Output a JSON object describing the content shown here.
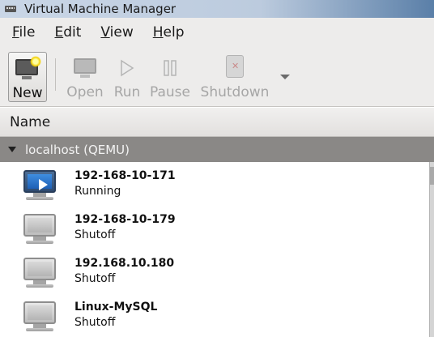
{
  "window": {
    "title": "Virtual Machine Manager",
    "icon": "vmm-app-icon"
  },
  "menu": [
    {
      "mnemonic": "F",
      "rest": "ile"
    },
    {
      "mnemonic": "E",
      "rest": "dit"
    },
    {
      "mnemonic": "V",
      "rest": "iew"
    },
    {
      "mnemonic": "H",
      "rest": "elp"
    }
  ],
  "toolbar": {
    "new_label": "New",
    "open_label": "Open",
    "run_label": "Run",
    "pause_label": "Pause",
    "shutdown_label": "Shutdown"
  },
  "list": {
    "column_header": "Name",
    "group_label": "localhost (QEMU)",
    "vms": [
      {
        "name": "192-168-10-171",
        "status": "Running",
        "icon": "vm-running-icon"
      },
      {
        "name": "192-168-10-179",
        "status": "Shutoff",
        "icon": "vm-off-icon"
      },
      {
        "name": "192.168.10.180",
        "status": "Shutoff",
        "icon": "vm-off-icon"
      },
      {
        "name": "Linux-MySQL",
        "status": "Shutoff",
        "icon": "vm-off-icon"
      }
    ]
  },
  "colors": {
    "group_bg": "#8a8886",
    "toolbar_bg": "#edeceb",
    "running_screen": "#2f7bd6"
  }
}
